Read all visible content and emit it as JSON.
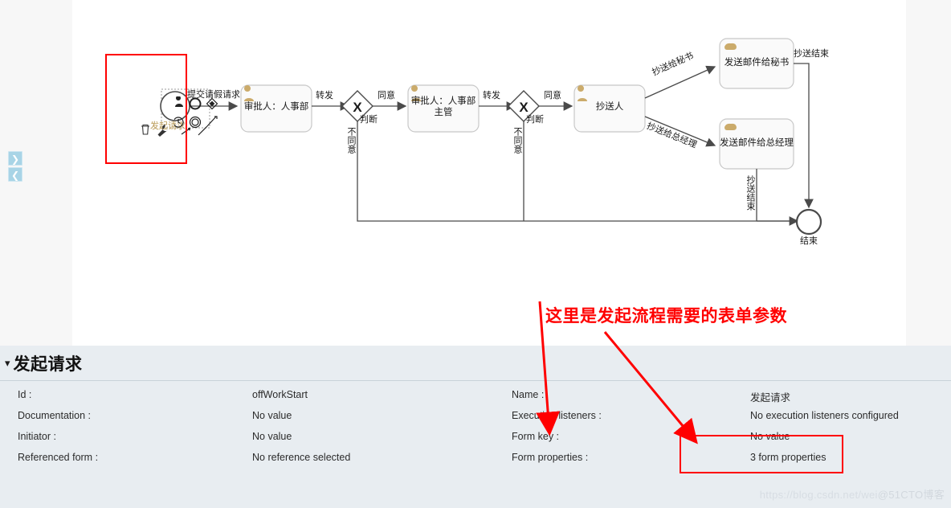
{
  "left_rail": {
    "buttons": [
      {
        "name": "expand-right",
        "glyph": "❯"
      },
      {
        "name": "collapse-left",
        "glyph": "❮"
      }
    ]
  },
  "diagram": {
    "type": "bpmn-process",
    "start_event": {
      "label": "发起请求",
      "selected": true,
      "outgoing_label": "提交请假请求"
    },
    "context_pad": {
      "delete_icon": "trash-icon",
      "wrench_icon": "wrench-icon",
      "items": [
        "append-user-task",
        "append-end-event",
        "append-gateway",
        "append-intermediate-event",
        "append-terminate-event",
        "connect-tool"
      ]
    },
    "nodes": [
      {
        "id": "task1",
        "kind": "user-task",
        "label": "审批人：人事部"
      },
      {
        "id": "gw1",
        "kind": "exclusive-gateway",
        "label": "判断",
        "symbol": "X"
      },
      {
        "id": "task2",
        "kind": "user-task",
        "label": "审批人：人事部主管"
      },
      {
        "id": "gw2",
        "kind": "exclusive-gateway",
        "label": "判断",
        "symbol": "X"
      },
      {
        "id": "task3",
        "kind": "user-task",
        "label": "抄送人"
      },
      {
        "id": "task4",
        "kind": "service-task",
        "label": "发送邮件给秘书"
      },
      {
        "id": "task5",
        "kind": "service-task",
        "label": "发送邮件给总经理"
      },
      {
        "id": "end",
        "kind": "end-event",
        "label": "结束"
      }
    ],
    "flow_labels": {
      "start_to_task1": "提交请假请求",
      "task1_to_gw1": "转发",
      "gw1_to_task2": "同意",
      "gw1_reject": "不同意",
      "task2_to_gw2": "转发",
      "gw2_to_task3": "同意",
      "gw2_reject": "不同意",
      "task3_to_task4": "抄送给秘书",
      "task3_to_task5": "抄送给总经理",
      "task4_to_end": "抄送结束",
      "task5_to_end": "抄送结束"
    }
  },
  "annotation": {
    "text": "这里是发起流程需要的表单参数",
    "color": "#ff0000"
  },
  "properties_panel": {
    "title": "发起请求",
    "collapse_icon": "chevron-down-icon",
    "left_rows": [
      {
        "label": "Id :",
        "value": "offWorkStart"
      },
      {
        "label": "Documentation :",
        "value": "No value"
      },
      {
        "label": "Initiator :",
        "value": "No value"
      },
      {
        "label": "Referenced form :",
        "value": "No reference selected"
      }
    ],
    "right_rows": [
      {
        "label": "Name :",
        "value": "发起请求"
      },
      {
        "label": "Execution listeners :",
        "value": "No execution listeners configured"
      },
      {
        "label": "Form key :",
        "value": "No value"
      },
      {
        "label": "Form properties :",
        "value": "3 form properties"
      }
    ]
  },
  "watermark": {
    "url": "https://blog.csdn.net/wei",
    "site": "@51CTO博客"
  }
}
